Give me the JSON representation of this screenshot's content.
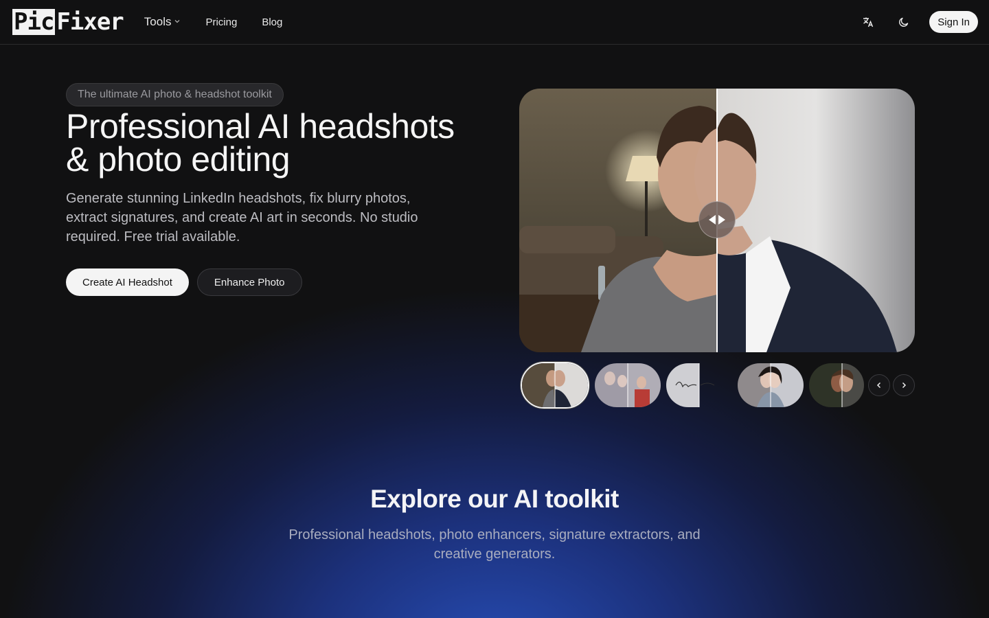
{
  "header": {
    "logo_part1": "Pic",
    "logo_part2": "Fixer",
    "nav": {
      "tools": "Tools",
      "pricing": "Pricing",
      "blog": "Blog"
    },
    "signin": "Sign In",
    "icons": [
      "translate-icon",
      "moon-icon",
      "chevron-down-icon"
    ]
  },
  "hero": {
    "badge": " The ultimate AI photo & headshot toolkit",
    "title_line1": "Professional AI headshots",
    "title_line2": "& photo editing",
    "subtitle": "Generate stunning LinkedIn headshots, fix blurry photos, extract signatures, and create AI art in seconds. No studio required. Free trial available.",
    "primary_button": "Create AI Headshot",
    "secondary_button": "Enhance Photo"
  },
  "carousel": {
    "active_index": 0,
    "thumbnails": [
      "headshot-comparison",
      "family-photo-comparison",
      "signature-comparison",
      "portrait-comparison",
      "face-restore-comparison"
    ]
  },
  "section": {
    "title": "Explore our AI toolkit",
    "subtitle": "Professional headshots, photo enhancers, signature extractors, and creative generators."
  },
  "colors": {
    "background": "#111112",
    "accent_glow": "#2850be",
    "button_light": "#f4f4f4"
  }
}
